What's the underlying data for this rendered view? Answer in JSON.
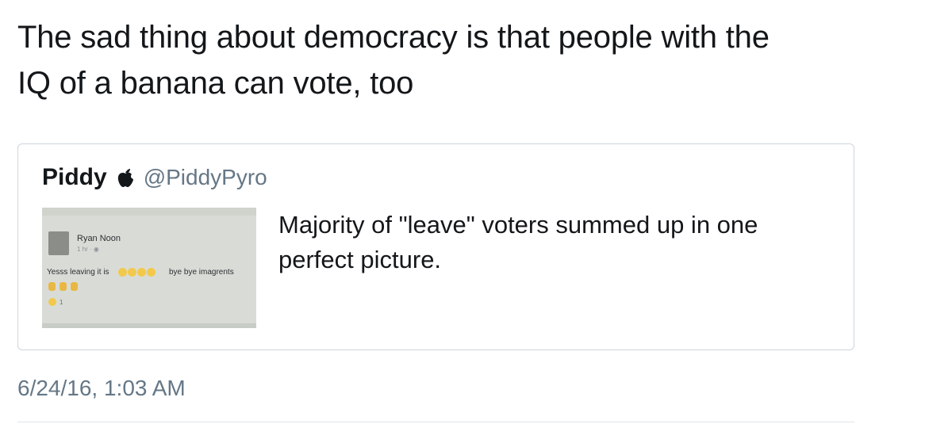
{
  "tweet": {
    "text_line1": "The sad thing about democracy is that people with the",
    "text_line2": "IQ of a banana can vote, too",
    "timestamp": "6/24/16, 1:03 AM"
  },
  "quoted_tweet": {
    "name": "Piddy",
    "badge_icon": "apple-icon",
    "handle": "@PiddyPyro",
    "text": "Majority of \"leave\" voters summed up in one perfect picture.",
    "media": {
      "poster_name": "Ryan Noon",
      "post_time": "1 hr · ",
      "post_text_start": "Yesss leaving it is",
      "post_text_end": "bye bye imagrents",
      "reaction_count": "1"
    }
  },
  "colors": {
    "text_primary": "#14171a",
    "text_secondary": "#657786",
    "border": "#ccd6dd"
  }
}
